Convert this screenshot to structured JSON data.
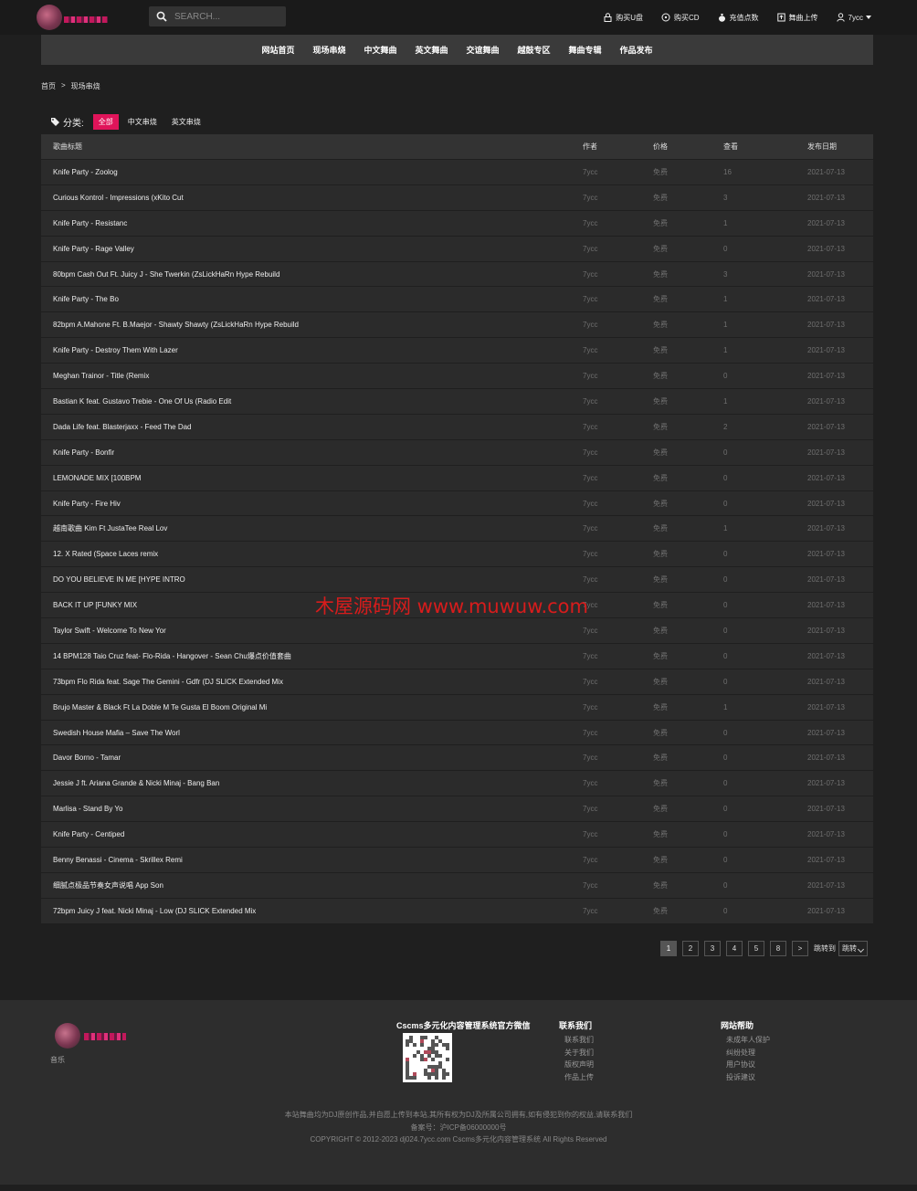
{
  "header": {
    "search_placeholder": "SEARCH...",
    "links": [
      {
        "label": "购买U盘",
        "icon": "lock-icon"
      },
      {
        "label": "购买CD",
        "icon": "disc-icon"
      },
      {
        "label": "充值点数",
        "icon": "money-bag-icon"
      },
      {
        "label": "舞曲上传",
        "icon": "upload-icon"
      },
      {
        "label": "7ycc",
        "icon": "user-icon"
      }
    ]
  },
  "nav": [
    "网站首页",
    "现场串烧",
    "中文舞曲",
    "英文舞曲",
    "交谊舞曲",
    "越鼓专区",
    "舞曲专辑",
    "作品发布"
  ],
  "breadcrumb": {
    "home": "首页",
    "sep": ">",
    "current": "现场串烧"
  },
  "categories": {
    "label": "分类:",
    "items": [
      "全部",
      "中文串烧",
      "英文串烧"
    ],
    "active": 0
  },
  "table": {
    "headers": {
      "title": "歌曲标题",
      "author": "作者",
      "price": "价格",
      "views": "查看",
      "date": "发布日期"
    },
    "rows": [
      {
        "title": "Knife Party - Zoolog",
        "author": "7ycc",
        "price": "免费",
        "views": "16",
        "date": "2021-07-13"
      },
      {
        "title": "Curious Kontrol - Impressions (xKito Cut",
        "author": "7ycc",
        "price": "免费",
        "views": "3",
        "date": "2021-07-13"
      },
      {
        "title": "Knife Party - Resistanc",
        "author": "7ycc",
        "price": "免费",
        "views": "1",
        "date": "2021-07-13"
      },
      {
        "title": "Knife Party - Rage Valley",
        "author": "7ycc",
        "price": "免费",
        "views": "0",
        "date": "2021-07-13"
      },
      {
        "title": "80bpm Cash Out Ft. Juicy J - She Twerkin (ZsLickHaRn Hype Rebuild",
        "author": "7ycc",
        "price": "免费",
        "views": "3",
        "date": "2021-07-13"
      },
      {
        "title": "Knife Party - The Bo",
        "author": "7ycc",
        "price": "免费",
        "views": "1",
        "date": "2021-07-13"
      },
      {
        "title": "82bpm A.Mahone Ft. B.Maejor - Shawty Shawty (ZsLickHaRn Hype Rebuild",
        "author": "7ycc",
        "price": "免费",
        "views": "1",
        "date": "2021-07-13"
      },
      {
        "title": "Knife Party - Destroy Them With Lazer",
        "author": "7ycc",
        "price": "免费",
        "views": "1",
        "date": "2021-07-13"
      },
      {
        "title": "Meghan Trainor - Title (Remix",
        "author": "7ycc",
        "price": "免费",
        "views": "0",
        "date": "2021-07-13"
      },
      {
        "title": "Bastian K feat. Gustavo Trebie - One Of Us (Radio Edit",
        "author": "7ycc",
        "price": "免费",
        "views": "1",
        "date": "2021-07-13"
      },
      {
        "title": "Dada Life feat. Blasterjaxx - Feed The Dad",
        "author": "7ycc",
        "price": "免费",
        "views": "2",
        "date": "2021-07-13"
      },
      {
        "title": "Knife Party - Bonfir",
        "author": "7ycc",
        "price": "免费",
        "views": "0",
        "date": "2021-07-13"
      },
      {
        "title": "LEMONADE MIX [100BPM",
        "author": "7ycc",
        "price": "免费",
        "views": "0",
        "date": "2021-07-13"
      },
      {
        "title": "Knife Party - Fire Hiv",
        "author": "7ycc",
        "price": "免费",
        "views": "0",
        "date": "2021-07-13"
      },
      {
        "title": "越南歌曲 Kim Ft JustaTee Real Lov",
        "author": "7ycc",
        "price": "免费",
        "views": "1",
        "date": "2021-07-13"
      },
      {
        "title": "12. X Rated (Space Laces remix",
        "author": "7ycc",
        "price": "免费",
        "views": "0",
        "date": "2021-07-13"
      },
      {
        "title": "DO YOU BELIEVE IN ME [HYPE INTRO",
        "author": "7ycc",
        "price": "免费",
        "views": "0",
        "date": "2021-07-13"
      },
      {
        "title": "BACK IT UP [FUNKY MIX",
        "author": "7ycc",
        "price": "免费",
        "views": "0",
        "date": "2021-07-13"
      },
      {
        "title": "Taylor Swift - Welcome To New Yor",
        "author": "7ycc",
        "price": "免费",
        "views": "0",
        "date": "2021-07-13"
      },
      {
        "title": "14 BPM128 Taio Cruz feat- Flo-Rida - Hangover - Sean Chu爆点价值套曲",
        "author": "7ycc",
        "price": "免费",
        "views": "0",
        "date": "2021-07-13"
      },
      {
        "title": "73bpm Flo Rida feat. Sage The Gemini - Gdfr (DJ SLICK Extended Mix",
        "author": "7ycc",
        "price": "免费",
        "views": "0",
        "date": "2021-07-13"
      },
      {
        "title": "Brujo Master & Black Ft La Doble M Te Gusta El Boom Original Mi",
        "author": "7ycc",
        "price": "免费",
        "views": "1",
        "date": "2021-07-13"
      },
      {
        "title": "Swedish House Mafia – Save The Worl",
        "author": "7ycc",
        "price": "免费",
        "views": "0",
        "date": "2021-07-13"
      },
      {
        "title": "Davor Borno - Tamar",
        "author": "7ycc",
        "price": "免费",
        "views": "0",
        "date": "2021-07-13"
      },
      {
        "title": "Jessie J ft. Ariana Grande & Nicki Minaj - Bang Ban",
        "author": "7ycc",
        "price": "免费",
        "views": "0",
        "date": "2021-07-13"
      },
      {
        "title": "Marlisa - Stand By Yo",
        "author": "7ycc",
        "price": "免费",
        "views": "0",
        "date": "2021-07-13"
      },
      {
        "title": "Knife Party - Centiped",
        "author": "7ycc",
        "price": "免费",
        "views": "0",
        "date": "2021-07-13"
      },
      {
        "title": "Benny Benassi - Cinema - Skrillex Remi",
        "author": "7ycc",
        "price": "免费",
        "views": "0",
        "date": "2021-07-13"
      },
      {
        "title": "细腻点极品节奏女声说唱 App Son",
        "author": "7ycc",
        "price": "免费",
        "views": "0",
        "date": "2021-07-13"
      },
      {
        "title": "72bpm Juicy J feat. Nicki Minaj - Low (DJ SLICK Extended Mix",
        "author": "7ycc",
        "price": "免费",
        "views": "0",
        "date": "2021-07-13"
      }
    ]
  },
  "pagination": {
    "pages": [
      "1",
      "2",
      "3",
      "4",
      "5",
      "8"
    ],
    "active": "1",
    "next": ">",
    "jump_label": "跳转到",
    "jump_value": "跳转"
  },
  "watermark": "木屋源码网 www.muwuw.com",
  "footer": {
    "logo_caption": "音乐",
    "wechat_title": "Cscms多元化内容管理系统官方微信",
    "contact": {
      "title": "联系我们",
      "links": [
        "联系我们",
        "关于我们",
        "版权声明",
        "作品上传"
      ]
    },
    "help": {
      "title": "网站帮助",
      "links": [
        "未成年人保护",
        "纠纷处理",
        "用户协议",
        "投诉建议"
      ]
    },
    "copy_lines": [
      "本站舞曲均为DJ原创作品,并自愿上传到本站,其所有权为DJ及所属公司拥有,如有侵犯到你的权益,请联系我们",
      "备案号：沪ICP备06000000号",
      "COPYRIGHT © 2012-2023 dj024.7ycc.com Cscms多元化内容管理系统 All Rights Reserved"
    ]
  },
  "colors": {
    "accent": "#e0145a",
    "watermark": "#d71c1c",
    "bg": "#1f1f1f",
    "row": "#2b2b2b"
  }
}
